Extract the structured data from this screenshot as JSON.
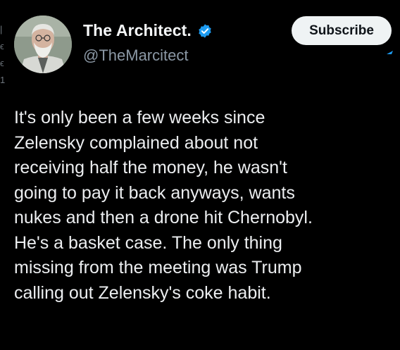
{
  "author": {
    "display_name": "The Architect.",
    "handle": "@TheMarcitect",
    "verified_icon": "verified-badge-icon",
    "avatar_icon": "profile-avatar"
  },
  "actions": {
    "subscribe_label": "Subscribe"
  },
  "tweet": {
    "text": "It's only been a few weeks since\nZelensky complained about not\nreceiving half the money, he wasn't\ngoing to pay it back anyways, wants\nnukes and then a drone hit Chernobyl.\nHe's a basket case. The only thing\nmissing from the meeting was Trump\ncalling out Zelensky's coke habit."
  },
  "colors": {
    "background": "#000000",
    "verified_blue": "#1d9bf0",
    "subscribe_bg": "#eff3f4"
  }
}
